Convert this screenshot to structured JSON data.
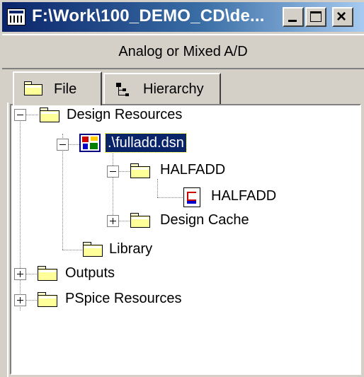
{
  "window": {
    "title": "F:\\Work\\100_DEMO_CD\\de...",
    "min_label": "_",
    "max_label": "□",
    "close_label": "×"
  },
  "project_type": "Analog or Mixed A/D",
  "tabs": [
    {
      "label": "File",
      "icon": "folder-icon",
      "active": true
    },
    {
      "label": "Hierarchy",
      "icon": "hierarchy-icon",
      "active": false
    }
  ],
  "tree": {
    "design_resources": "Design Resources",
    "dsn_file": ".\\fulladd.dsn",
    "halfadd_folder": "HALFADD",
    "halfadd_page": "HALFADD",
    "design_cache": "Design Cache",
    "library": "Library",
    "outputs": "Outputs",
    "pspice_resources": "PSpice Resources"
  },
  "colors": {
    "title_bar_start": "#0a246a",
    "selection": "#0a246a",
    "face": "#d4d0c8"
  }
}
